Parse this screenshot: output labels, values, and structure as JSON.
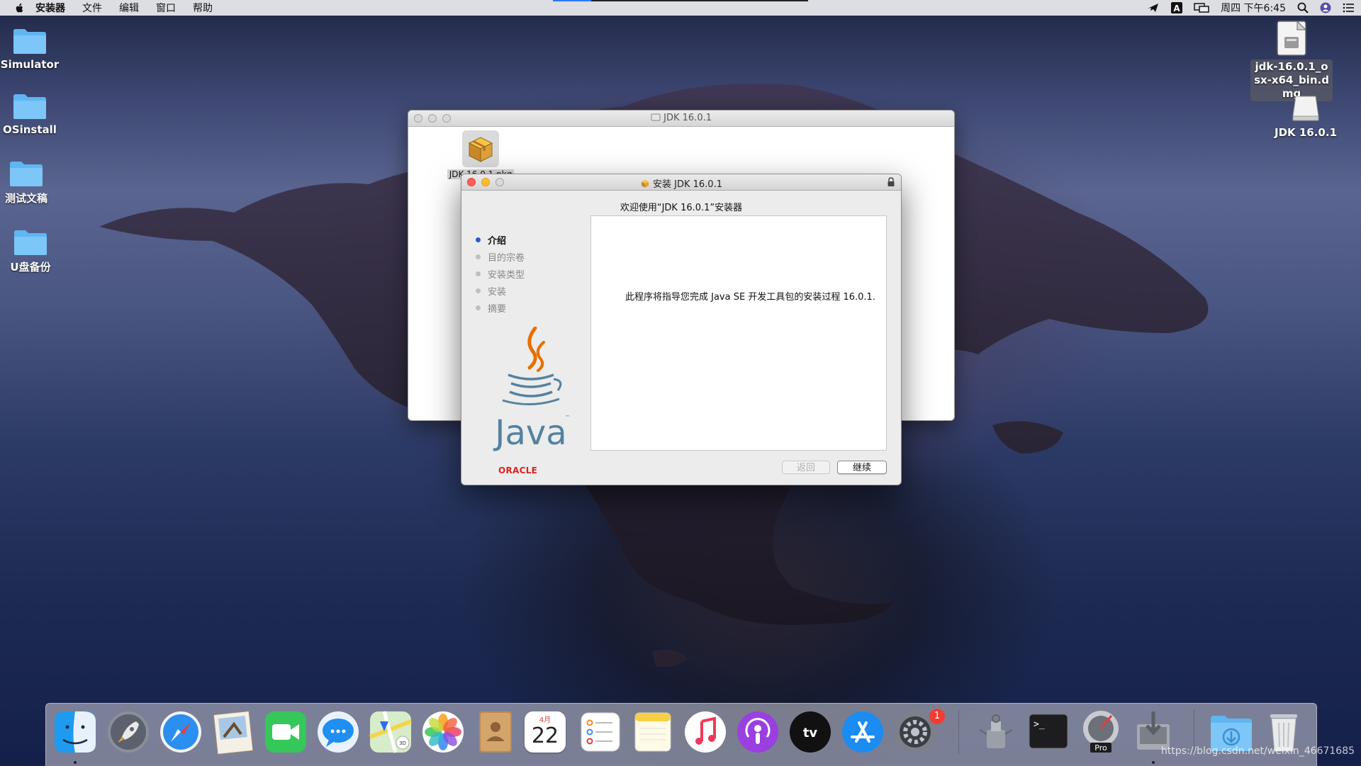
{
  "menubar": {
    "app_name": "安装器",
    "items": [
      "文件",
      "编辑",
      "窗口",
      "帮助"
    ],
    "datetime": "周四 下午6:45",
    "download_progress": 0.15
  },
  "desktop": {
    "icons": [
      {
        "label": "Simulator"
      },
      {
        "label": "OSinstall"
      },
      {
        "label": "测试文稿"
      },
      {
        "label": "U盘备份"
      }
    ],
    "dmg_file": {
      "label": "jdk-16.0.1_osx-x64_bin.dmg"
    },
    "mounted_volume": {
      "label": "JDK 16.0.1"
    }
  },
  "finder_window": {
    "title": "JDK 16.0.1",
    "file": {
      "label": "JDK 16.0.1.pkg"
    }
  },
  "installer": {
    "title": "安装 JDK 16.0.1",
    "welcome": "欢迎使用“JDK 16.0.1”安装器",
    "steps": [
      {
        "label": "介绍",
        "active": true
      },
      {
        "label": "目的宗卷",
        "active": false
      },
      {
        "label": "安装类型",
        "active": false
      },
      {
        "label": "安装",
        "active": false
      },
      {
        "label": "摘要",
        "active": false
      }
    ],
    "message": "此程序将指导您完成 Java SE 开发工具包的安装过程 16.0.1.",
    "java_word": "Java",
    "oracle": "ORACLE",
    "back_label": "返回",
    "continue_label": "继续"
  },
  "dock": {
    "apps": [
      "finder",
      "launchpad",
      "safari",
      "mail",
      "facetime",
      "messages",
      "maps",
      "photos",
      "contacts",
      "calendar",
      "reminders",
      "notes",
      "music",
      "podcasts",
      "tv",
      "app-store",
      "system-preferences",
      "archive-utility",
      "terminal",
      "instruments",
      "installer",
      "downloads",
      "trash"
    ],
    "calendar_month": "4月",
    "calendar_day": "22",
    "settings_badge": "1",
    "instruments_badge": "Pro"
  },
  "watermark": "https://blog.csdn.net/weixin_46671685",
  "colors": {
    "accent": "#1f5fd6",
    "oracle_red": "#e0201a",
    "close_red": "#fe5f57",
    "min_yellow": "#febc2e",
    "java_blue": "#5382a1",
    "java_orange": "#e76f00"
  }
}
